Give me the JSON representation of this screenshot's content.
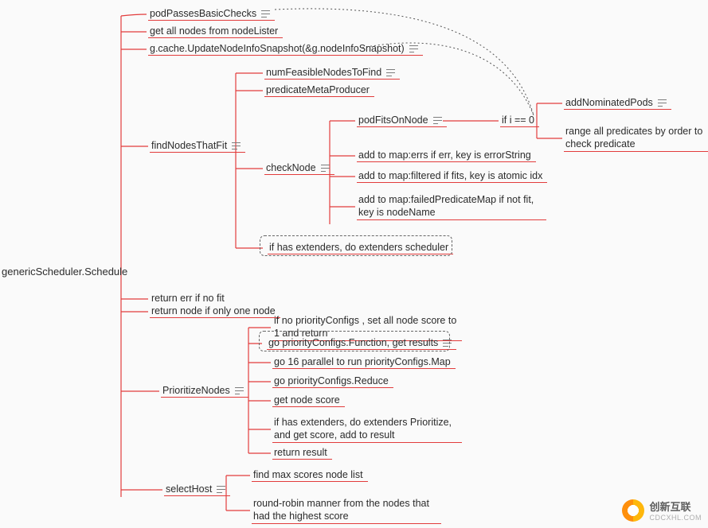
{
  "root": "genericScheduler.Schedule",
  "level1": {
    "podPasses": "podPassesBasicChecks",
    "getAllNodes": "get all nodes from nodeLister",
    "updateSnapshot": "g.cache.UpdateNodeInfoSnapshot(&g.nodeInfoSnapshot)",
    "findNodes": "findNodesThatFit",
    "retErr": "return err if no fit",
    "retNode": "return node if only one node",
    "prioritize": "PrioritizeNodes",
    "selectHost": "selectHost"
  },
  "findNodes": {
    "numFeasible": "numFeasibleNodesToFind",
    "predMeta": "predicateMetaProducer",
    "checkNode": "checkNode",
    "ifExtenders": "if has extenders, do extenders scheduler"
  },
  "checkNode": {
    "podFits": "podFitsOnNode",
    "addErrs": "add to map:errs if err, key is errorString",
    "addFiltered": "add to map:filtered if fits, key is atomic idx",
    "addFailed": "add to map:failedPredicateMap if not fit, key is nodeName"
  },
  "podFits": {
    "ifi0": "if i == 0",
    "addNominated": "addNominatedPods",
    "rangePred": "range all predicates by order to check predicate"
  },
  "prioritize": {
    "noPri": "if no priorityConfigs , set all node score to 1 and return",
    "goFunc": "go priorityConfigs.Function, get results",
    "go16": "go 16 parallel to run priorityConfigs.Map",
    "goReduce": "go priorityConfigs.Reduce",
    "getScore": "get node score",
    "extenders": "if has extenders, do extenders Prioritize, and get score, add to result",
    "retRes": "return result"
  },
  "selectHost": {
    "findMax": "find max scores node list",
    "rr": "round-robin manner from the nodes that had the highest score"
  },
  "watermark": {
    "brand": "创新互联",
    "sub": "CDCXHL.COM"
  }
}
